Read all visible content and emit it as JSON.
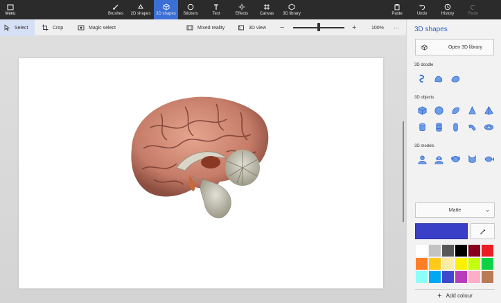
{
  "topbar": {
    "menu_label": "Menu",
    "tools": [
      {
        "label": "Brushes"
      },
      {
        "label": "2D shapes"
      },
      {
        "label": "3D shapes"
      },
      {
        "label": "Stickers"
      },
      {
        "label": "Text"
      },
      {
        "label": "Effects"
      },
      {
        "label": "Canvas"
      },
      {
        "label": "3D library"
      }
    ],
    "actions": {
      "paste": "Paste",
      "undo": "Undo",
      "history": "History",
      "redo": "Redo"
    },
    "active_color": "#3b6fd4"
  },
  "toolbar2": {
    "select": "Select",
    "crop": "Crop",
    "magic_select": "Magic select",
    "mixed_reality": "Mixed reality",
    "view_3d": "3D view",
    "zoom_out": "−",
    "zoom_in": "+",
    "zoom": "100%",
    "more": "···"
  },
  "panel": {
    "title": "3D shapes",
    "open_library": "Open 3D library",
    "doodle_label": "3D doodle",
    "objects_label": "3D objects",
    "models_label": "3D models",
    "material": "Matte",
    "current_color": "#3a3fc8",
    "add_colour": "Add colour",
    "palette": [
      "#ffffff",
      "#c3c3c3",
      "#585858",
      "#000000",
      "#88001b",
      "#ec1c24",
      "#ff7f27",
      "#ffca18",
      "#fdeca6",
      "#fff200",
      "#c4ff0e",
      "#0ed145",
      "#8cfffb",
      "#00a8f3",
      "#3f48cc",
      "#b83dba",
      "#ffaec8",
      "#b97a56"
    ]
  }
}
